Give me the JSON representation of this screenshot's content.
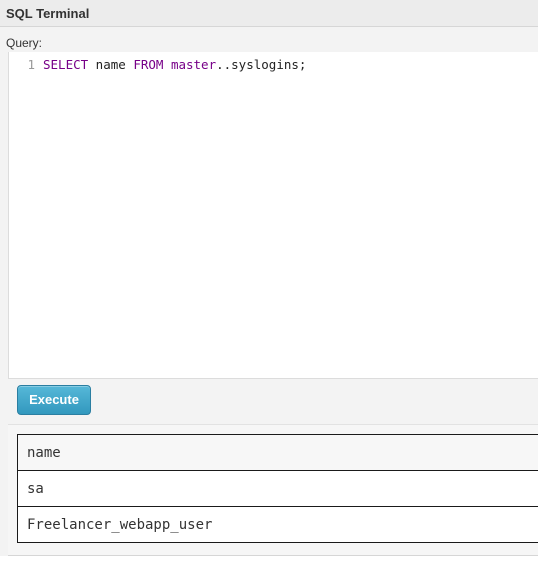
{
  "window": {
    "title": "SQL Terminal"
  },
  "query": {
    "label": "Query:",
    "line_number": "1",
    "tokens": {
      "kw_select": "SELECT",
      "col_name": " name ",
      "kw_from": "FROM",
      "db_master": " master",
      "table": "..syslogins;"
    }
  },
  "actions": {
    "execute_label": "Execute"
  },
  "results": {
    "columns": [
      "name"
    ],
    "rows": [
      [
        "sa"
      ],
      [
        "Freelancer_webapp_user"
      ]
    ]
  },
  "colors": {
    "keyword": "#770088",
    "button": "#3298be"
  }
}
